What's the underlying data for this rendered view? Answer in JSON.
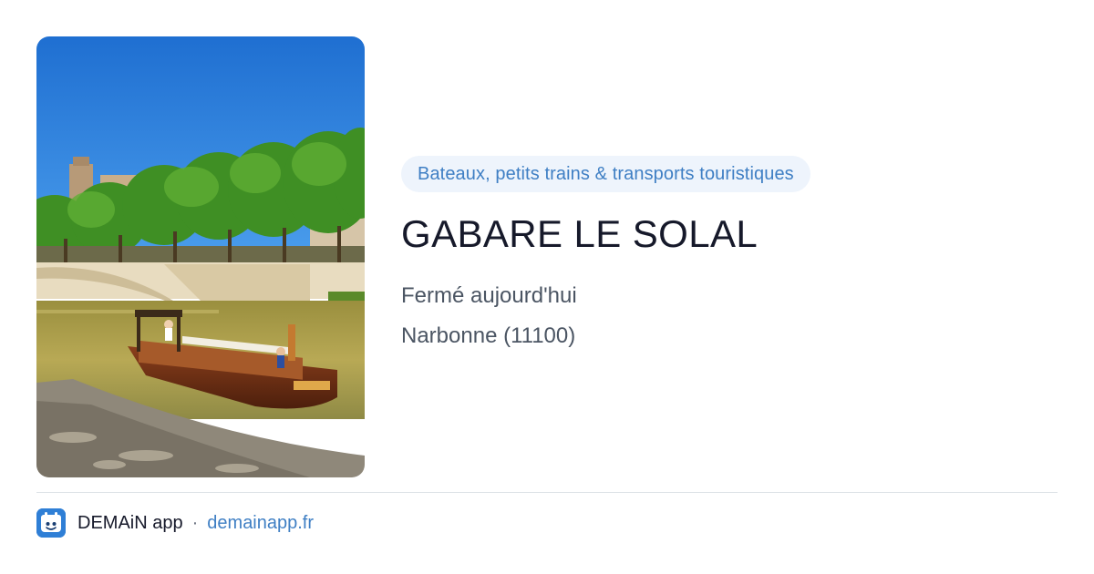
{
  "listing": {
    "photo_alt": "Gabare sur le canal à Narbonne",
    "category": "Bateaux, petits trains & transports touristiques",
    "title": "GABARE LE SOLAL",
    "status": "Fermé aujourd'hui",
    "location": "Narbonne (11100)"
  },
  "footer": {
    "app_icon": "demain-app-icon",
    "app_name": "DEMAiN app",
    "separator": "·",
    "domain": "demainapp.fr"
  },
  "colors": {
    "category_bg": "#eef4fc",
    "category_text": "#3f7fc4",
    "title_text": "#16192a",
    "muted_text": "#4b5563",
    "link": "#3f7fc4",
    "app_icon_bg": "#2f7fd6"
  }
}
